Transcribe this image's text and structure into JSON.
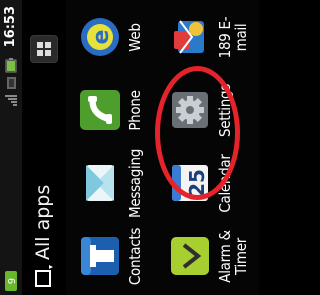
{
  "status_bar": {
    "time": "16:53",
    "notification_count": "9"
  },
  "header": {
    "title": "All apps"
  },
  "apps": [
    {
      "label": "Contacts",
      "icon": "contacts-icon"
    },
    {
      "label": "Messaging",
      "icon": "messaging-icon"
    },
    {
      "label": "Phone",
      "icon": "phone-icon"
    },
    {
      "label": "Web",
      "icon": "web-icon"
    },
    {
      "label": "Alarm & Timer",
      "label_line1": "Alarm &",
      "label_line2": "Timer",
      "icon": "alarm-icon"
    },
    {
      "label": "Calendar",
      "icon": "calendar-icon",
      "badge": "25"
    },
    {
      "label": "Settings",
      "icon": "settings-gear-icon"
    },
    {
      "label": "189 E-mail",
      "label_line1": "189 E-",
      "label_line2": "mail",
      "icon": "email-icon"
    }
  ],
  "colors": {
    "highlight": "#e4232a",
    "accent_green": "#7bc043"
  }
}
